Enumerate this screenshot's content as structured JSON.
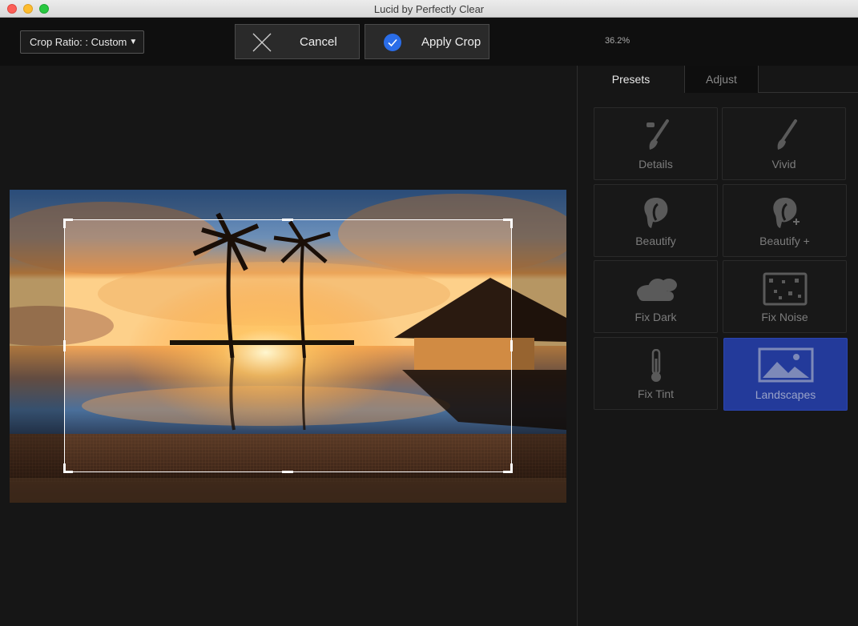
{
  "window": {
    "title": "Lucid by Perfectly Clear"
  },
  "toolbar": {
    "crop_ratio_label": "Crop Ratio: : Custom",
    "cancel_label": "Cancel",
    "apply_label": "Apply Crop",
    "zoom": "36.2%"
  },
  "panel": {
    "tabs": [
      {
        "label": "Presets",
        "active": true
      },
      {
        "label": "Adjust",
        "active": false
      }
    ],
    "presets": [
      {
        "label": "Details",
        "icon": "brush-icon"
      },
      {
        "label": "Vivid",
        "icon": "brush-icon"
      },
      {
        "label": "Beautify",
        "icon": "face-icon"
      },
      {
        "label": "Beautify +",
        "icon": "face-plus-icon"
      },
      {
        "label": "Fix Dark",
        "icon": "cloud-icon"
      },
      {
        "label": "Fix Noise",
        "icon": "noise-icon"
      },
      {
        "label": "Fix Tint",
        "icon": "thermometer-icon"
      },
      {
        "label": "Landscapes",
        "icon": "landscape-icon",
        "active": true
      }
    ]
  },
  "colors": {
    "accent": "#2a6de8",
    "active_preset": "#233a9a"
  }
}
